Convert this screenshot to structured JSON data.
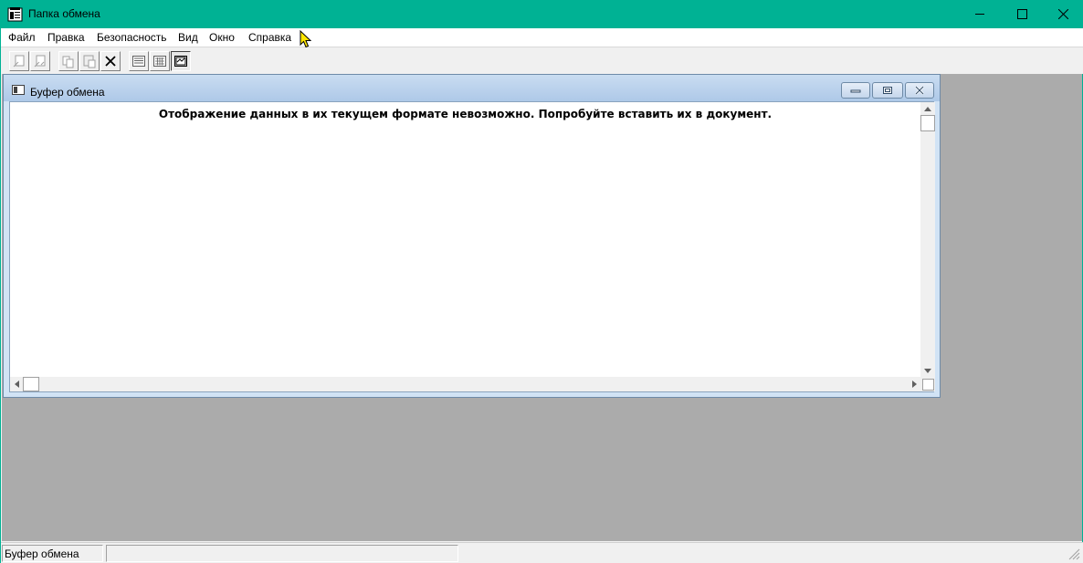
{
  "window": {
    "title": "Папка обмена",
    "accent_color": "#00b294",
    "controls": [
      "minimize-icon",
      "maximize-icon",
      "close-icon"
    ]
  },
  "menu": {
    "items": [
      "Файл",
      "Правка",
      "Безопасность",
      "Вид",
      "Окно",
      "Справка"
    ]
  },
  "toolbar": {
    "buttons": [
      "connect-icon",
      "disconnect-icon",
      "share-icon",
      "unshare-icon",
      "delete-icon",
      "list-view-icon",
      "grid-view-icon",
      "page-view-icon"
    ],
    "pressed": "page-view-icon"
  },
  "child_window": {
    "title": "Буфер обмена",
    "message": "Отображение данных в их текущем формате невозможно. Попробуйте вставить их в документ."
  },
  "status": {
    "text": "Буфер обмена"
  }
}
